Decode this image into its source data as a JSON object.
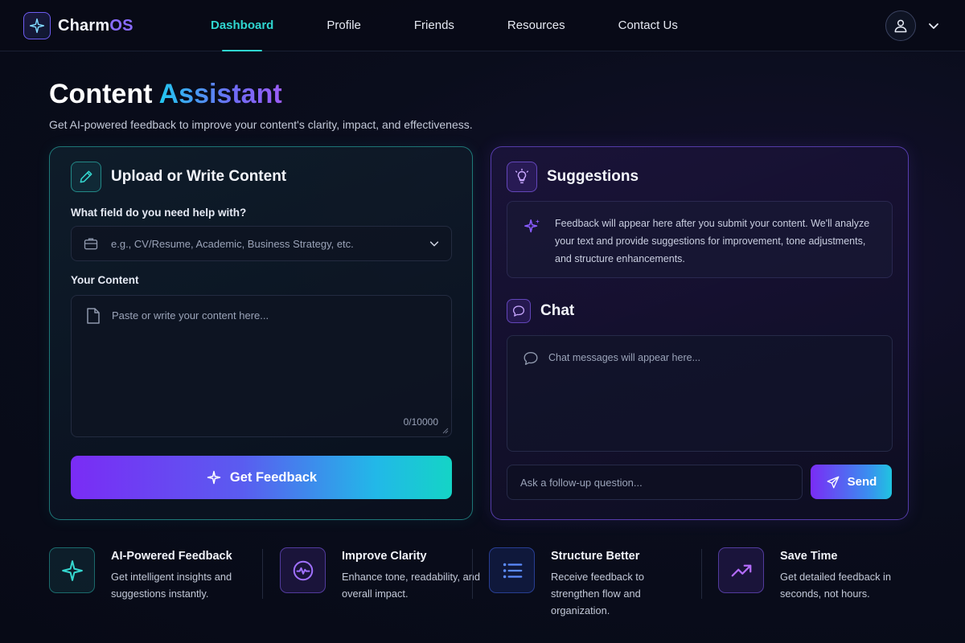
{
  "brand": {
    "name_part1": "Charm",
    "name_part2": "OS"
  },
  "nav": {
    "items": [
      {
        "label": "Dashboard",
        "active": true
      },
      {
        "label": "Profile"
      },
      {
        "label": "Friends"
      },
      {
        "label": "Resources"
      },
      {
        "label": "Contact Us"
      }
    ]
  },
  "header": {
    "title_main": "Content",
    "title_accent": "Assistant",
    "subtitle": "Get AI-powered feedback to improve your content's clarity, impact, and effectiveness."
  },
  "upload_panel": {
    "title": "Upload or Write Content",
    "field_label": "What field do you need help with?",
    "field_placeholder": "e.g., CV/Resume, Academic, Business Strategy, etc.",
    "content_label": "Your Content",
    "content_placeholder": "Paste or write your content here...",
    "char_count": "0/10000",
    "submit_label": "Get Feedback"
  },
  "suggestions_panel": {
    "title": "Suggestions",
    "placeholder": "Feedback will appear here after you submit your content. We'll analyze your text and provide suggestions for improvement, tone adjustments, and structure enhancements."
  },
  "chat_panel": {
    "title": "Chat",
    "messages_placeholder": "Chat messages will appear here...",
    "input_placeholder": "Ask a follow-up question...",
    "send_label": "Send"
  },
  "features": [
    {
      "title": "AI-Powered Feedback",
      "description": "Get intelligent insights and suggestions instantly.",
      "icon": "sparkle-icon"
    },
    {
      "title": "Improve Clarity",
      "description": "Enhance tone, readability, and overall impact.",
      "icon": "pulse-icon"
    },
    {
      "title": "Structure Better",
      "description": "Receive feedback to strengthen flow and organization.",
      "icon": "list-icon"
    },
    {
      "title": "Save Time",
      "description": "Get detailed feedback in seconds, not hours.",
      "icon": "trending-up-icon"
    }
  ],
  "colors": {
    "background": "#0a0d1c",
    "teal_accent": "#2fd6d0",
    "purple_accent": "#7a2cf5",
    "brand_purple": "#8a6cff"
  }
}
